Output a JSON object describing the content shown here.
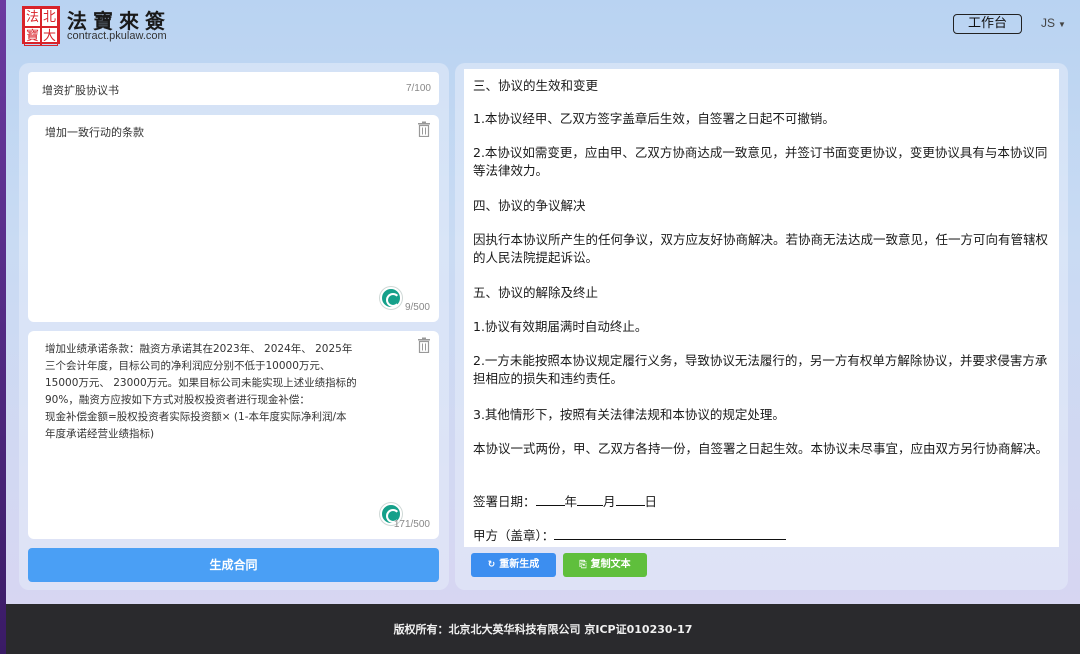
{
  "header": {
    "seal_chars": [
      "法",
      "北",
      "寶",
      "大"
    ],
    "title": "法寶來簽",
    "subtitle": "contract.pkulaw.com",
    "workbench_label": "工作台",
    "user_initials": "JS"
  },
  "left": {
    "title_value": "增资扩股协议书",
    "title_count": "7/100",
    "card1_text": "增加一致行动的条款",
    "card1_count": "9/500",
    "card2_text": "增加业绩承诺条款：融资方承诺其在2023年、 2024年、 2025年\n三个会计年度，目标公司的净利润应分别不低于10000万元、\n15000万元、 23000万元。如果目标公司未能实现上述业绩指标的\n90%，融资方应按如下方式对股权投资者进行现金补偿：\n现金补偿金额=股权投资者实际投资额× (1-本年度实际净利润/本\n年度承诺经营业绩指标)",
    "card2_count": "171/500",
    "generate_label": "生成合同"
  },
  "doc": {
    "p1": "三、协议的生效和变更",
    "p2": "1.本协议经甲、乙双方签字盖章后生效，自签署之日起不可撤销。",
    "p3": "2.本协议如需变更，应由甲、乙双方协商达成一致意见，并签订书面变更协议，变更协议具有与本协议同等法律效力。",
    "p4": "四、协议的争议解决",
    "p5": "因执行本协议所产生的任何争议，双方应友好协商解决。若协商无法达成一致意见，任一方可向有管辖权的人民法院提起诉讼。",
    "p6": "五、协议的解除及终止",
    "p7": "1.协议有效期届满时自动终止。",
    "p8": "2.一方未能按照本协议规定履行义务，导致协议无法履行的，另一方有权单方解除协议，并要求侵害方承担相应的损失和违约责任。",
    "p9": "3.其他情形下，按照有关法律法规和本协议的规定处理。",
    "p10": "本协议一式两份，甲、乙双方各持一份，自签署之日起生效。本协议未尽事宜，应由双方另行协商解决。",
    "sign_date_label": "签署日期：",
    "year": "年",
    "month": "月",
    "day": "日",
    "party_a_label": "甲方（盖章）："
  },
  "actions": {
    "regen_icon": "↻",
    "regen_label": "重新生成",
    "copy_icon": "⎘",
    "copy_label": "复制文本"
  },
  "footer": {
    "text": "版权所有：北京北大英华科技有限公司  京ICP证010230-17"
  }
}
